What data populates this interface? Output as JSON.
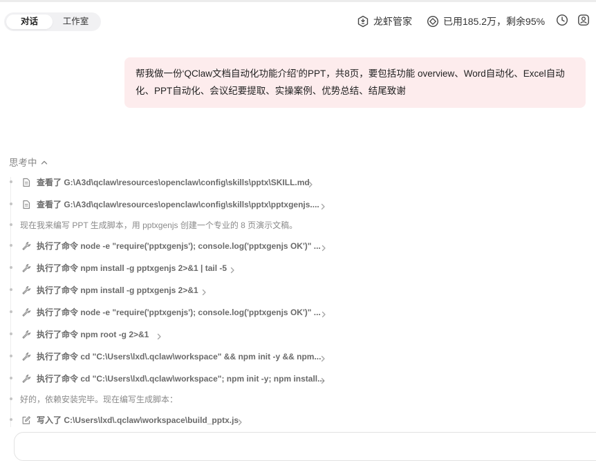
{
  "tabs": [
    {
      "label": "对话",
      "active": true
    },
    {
      "label": "工作室",
      "active": false
    }
  ],
  "header": {
    "assistant_label": "龙虾管家",
    "usage_label": "已用185.2万，剩余95%"
  },
  "user_message": {
    "line1": "帮我做一份‘QClaw文档自动化功能介绍’的PPT，共8页，要包括功能 overview、Word自动化、Excel自动",
    "line2": "化、PPT自动化、会议纪要提取、实操案例、优势总结、结尾致谢"
  },
  "thinking": {
    "label": "思考中",
    "steps": [
      {
        "icon": "document-icon",
        "text": "查看了 G:\\A3d\\qclaw\\resources\\openclaw\\config\\skills\\pptx\\SKILL.md",
        "expandable": true
      },
      {
        "icon": "document-icon",
        "text": "查看了 G:\\A3d\\qclaw\\resources\\openclaw\\config\\skills\\pptx\\pptxgenjs....",
        "expandable": true
      },
      {
        "icon": "",
        "text": "现在我来编写 PPT 生成脚本，用 pptxgenjs 创建一个专业的 8 页演示文稿。",
        "expandable": false
      },
      {
        "icon": "wrench-icon",
        "text": "执行了命令 node -e \"require('pptxgenjs'); console.log('pptxgenjs OK')\" ...",
        "expandable": true
      },
      {
        "icon": "wrench-icon",
        "text": "执行了命令 npm install -g pptxgenjs 2>&1 | tail -5",
        "expandable": true
      },
      {
        "icon": "wrench-icon",
        "text": "执行了命令 npm install -g pptxgenjs 2>&1",
        "expandable": true
      },
      {
        "icon": "wrench-icon",
        "text": "执行了命令 node -e \"require('pptxgenjs'); console.log('pptxgenjs OK')\" ...",
        "expandable": true
      },
      {
        "icon": "wrench-icon",
        "text": "执行了命令 npm root -g 2>&1",
        "expandable": true
      },
      {
        "icon": "wrench-icon",
        "text": "执行了命令 cd \"C:\\Users\\lxd\\.qclaw\\workspace\" && npm init -y && npm...",
        "expandable": true
      },
      {
        "icon": "wrench-icon",
        "text": "执行了命令 cd \"C:\\Users\\lxd\\.qclaw\\workspace\"; npm init -y; npm install...",
        "expandable": true
      },
      {
        "icon": "",
        "text": "好的，依赖安装完毕。现在编写生成脚本：",
        "expandable": false
      },
      {
        "icon": "edit-icon",
        "text": "写入了 C:\\Users\\lxd\\.qclaw\\workspace\\build_pptx.js",
        "expandable": true
      }
    ]
  }
}
